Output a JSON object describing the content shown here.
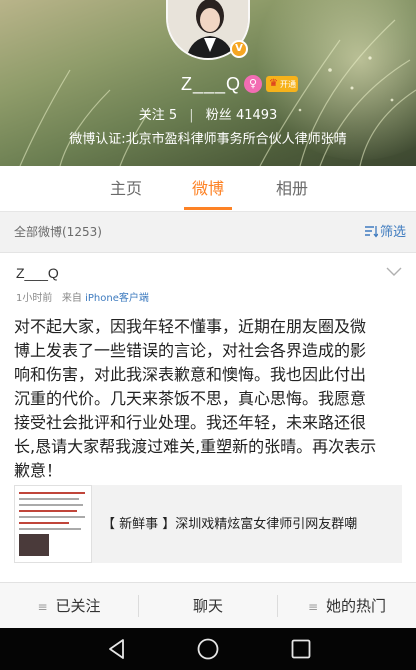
{
  "profile": {
    "username": "Z___Q",
    "avatar_badge": "V",
    "vip_label": "开通",
    "follow_label": "关注",
    "follow_count": "5",
    "fans_label": "粉丝",
    "fans_count": "41493",
    "verification": "微博认证:北京市盈科律师事务所合伙人律师张晴"
  },
  "tabs": [
    {
      "label": "主页"
    },
    {
      "label": "微博",
      "active": true
    },
    {
      "label": "相册"
    }
  ],
  "filter": {
    "title": "全部微博(1253)",
    "button_label": "筛选"
  },
  "post": {
    "author": "Z___Q",
    "time": "1小时前",
    "source_prefix": "来自",
    "source": "iPhone客户端",
    "lines": [
      "对不起大家，因我年轻不懂事，近期在朋友圈及微",
      "博上发表了一些错误的言论，对社会各界造成的影",
      "响和伤害，对此我深表歉意和懊悔。我也因此付出",
      "沉重的代价。几天来茶饭不思，真心思悔。我愿意",
      "接受社会批评和行业处理。我还年轻，未来路还很",
      "长,恳请大家帮我渡过难关,重塑新的张晴。再次表示",
      "歉意！"
    ],
    "share_title": "【 新鲜事 】深圳戏精炫富女律师引网友群嘲"
  },
  "actions": [
    {
      "label": "已关注"
    },
    {
      "label": "聊天"
    },
    {
      "label": "她的热门"
    }
  ],
  "colors": {
    "accent": "#fd8225",
    "link": "#3e7bbf"
  }
}
